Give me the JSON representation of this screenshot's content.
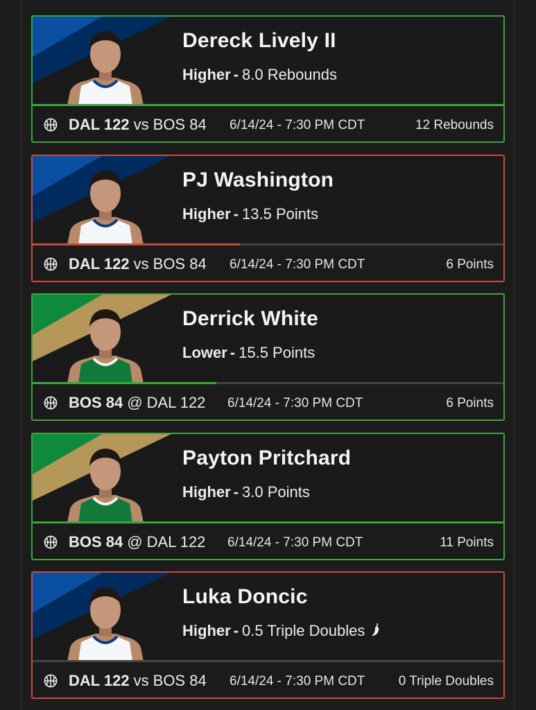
{
  "colors": {
    "win": "#3ea53f",
    "loss": "#c94c3c",
    "mavs_blue": "#0b4fa3",
    "mavs_navy": "#002b5e",
    "celtics_green": "#0f8a3c",
    "celtics_gold": "#b5975a"
  },
  "picks": [
    {
      "player": "Dereck Lively II",
      "direction": "Higher",
      "line": "8.0 Rebounds",
      "hot": false,
      "team": "DAL",
      "matchup": {
        "team": "DAL 122",
        "connector": "vs",
        "opponent": "BOS 84"
      },
      "game_time": "6/14/24 - 7:30 PM CDT",
      "result": "12 Rebounds",
      "status": "win",
      "progress": 1.0
    },
    {
      "player": "PJ Washington",
      "direction": "Higher",
      "line": "13.5 Points",
      "hot": false,
      "team": "DAL",
      "matchup": {
        "team": "DAL 122",
        "connector": "vs",
        "opponent": "BOS 84"
      },
      "game_time": "6/14/24 - 7:30 PM CDT",
      "result": "6 Points",
      "status": "loss",
      "progress": 0.44
    },
    {
      "player": "Derrick White",
      "direction": "Lower",
      "line": "15.5 Points",
      "hot": false,
      "team": "BOS",
      "matchup": {
        "team": "BOS 84",
        "connector": "@",
        "opponent": "DAL 122"
      },
      "game_time": "6/14/24 - 7:30 PM CDT",
      "result": "6 Points",
      "status": "win",
      "progress": 0.39
    },
    {
      "player": "Payton Pritchard",
      "direction": "Higher",
      "line": "3.0 Points",
      "hot": false,
      "team": "BOS",
      "matchup": {
        "team": "BOS 84",
        "connector": "@",
        "opponent": "DAL 122"
      },
      "game_time": "6/14/24 - 7:30 PM CDT",
      "result": "11 Points",
      "status": "win",
      "progress": 1.0
    },
    {
      "player": "Luka Doncic",
      "direction": "Higher",
      "line": "0.5 Triple Doubles",
      "hot": true,
      "team": "DAL",
      "matchup": {
        "team": "DAL 122",
        "connector": "vs",
        "opponent": "BOS 84"
      },
      "game_time": "6/14/24 - 7:30 PM CDT",
      "result": "0 Triple Doubles",
      "status": "loss",
      "progress": 0.0
    }
  ]
}
